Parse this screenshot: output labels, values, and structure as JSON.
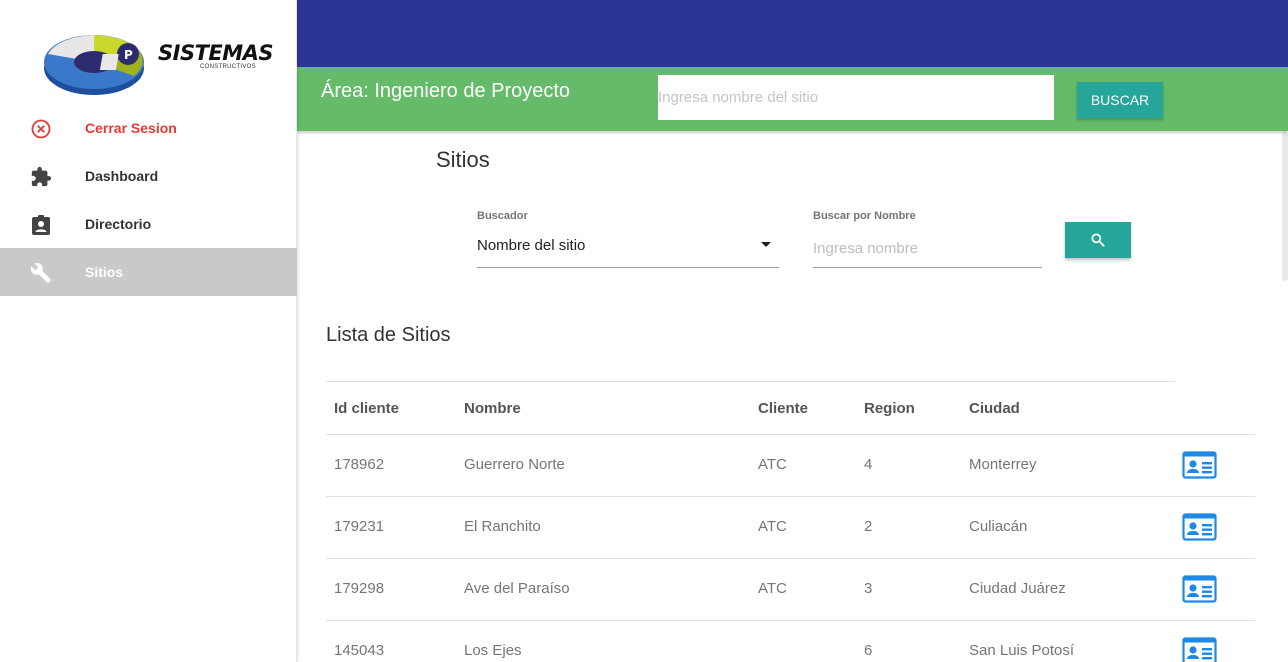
{
  "sidebar": {
    "logo_text": "SISTEMAS",
    "logo_sub": "CONSTRUCTIVOS",
    "items": [
      {
        "label": "Cerrar Sesion",
        "icon": "close-circle-icon"
      },
      {
        "label": "Dashboard",
        "icon": "puzzle-icon"
      },
      {
        "label": "Directorio",
        "icon": "contact-clipboard-icon"
      },
      {
        "label": "Sitios",
        "icon": "wrench-icon",
        "active": true
      }
    ]
  },
  "header": {
    "area_title": "Área: Ingeniero de Proyecto",
    "search_placeholder": "Ingresa nombre del sitio",
    "search_button": "BUSCAR"
  },
  "page": {
    "title": "Sitios",
    "filter": {
      "buscador_label": "Buscador",
      "buscador_value": "Nombre del sitio",
      "nombre_label": "Buscar por Nombre",
      "nombre_placeholder": "Ingresa nombre"
    },
    "list_title": "Lista de Sitios"
  },
  "table": {
    "columns": [
      "Id cliente",
      "Nombre",
      "Cliente",
      "Region",
      "Ciudad"
    ],
    "rows": [
      {
        "id": "178962",
        "nombre": "Guerrero Norte",
        "cliente": "ATC",
        "region": "4",
        "ciudad": "Monterrey"
      },
      {
        "id": "179231",
        "nombre": "El Ranchito",
        "cliente": "ATC",
        "region": "2",
        "ciudad": "Culiacán"
      },
      {
        "id": "179298",
        "nombre": "Ave del Paraíso",
        "cliente": "ATC",
        "region": "3",
        "ciudad": "Ciudad Juárez"
      },
      {
        "id": "145043",
        "nombre": "Los Ejes",
        "cliente": "",
        "region": "6",
        "ciudad": "San Luis Potosí"
      }
    ]
  },
  "colors": {
    "top_bar": "#2b3595",
    "green_bar": "#66bb6a",
    "accent_button": "#26a69a",
    "logout_red": "#e53935",
    "card_icon_blue": "#1e88e5"
  }
}
